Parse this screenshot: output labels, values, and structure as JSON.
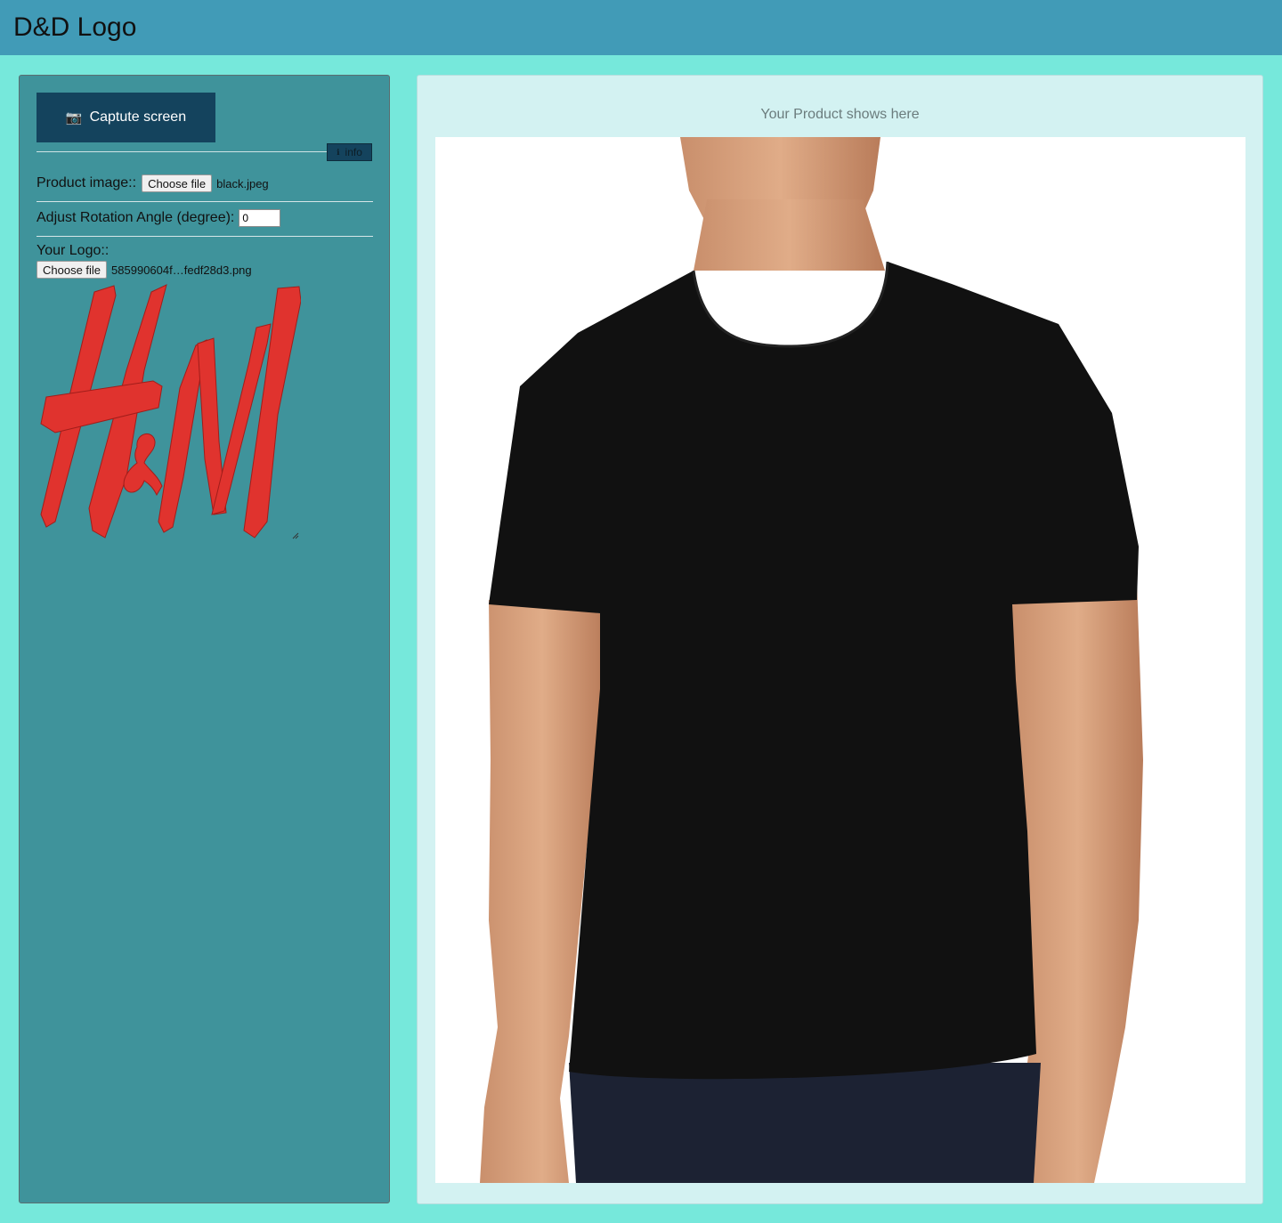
{
  "header": {
    "title": "D&D Logo"
  },
  "sidebar": {
    "capture_button": {
      "icon": "camera-icon",
      "label": "Captute screen"
    },
    "info_button": {
      "icon": "info-icon",
      "label": "info"
    },
    "product_image": {
      "label": "Product image::",
      "button": "Choose file",
      "filename": "black.jpeg"
    },
    "rotation": {
      "label": "Adjust Rotation Angle (degree):",
      "value": "0"
    },
    "logo": {
      "label": "Your Logo::",
      "button": "Choose file",
      "filename": "585990604f…fedf28d3.png",
      "image_text": "H&M",
      "color": "#e0332e"
    }
  },
  "main": {
    "placeholder": "Your Product shows here",
    "product_description": "black crew-neck t-shirt on model",
    "shirt_color": "#111111"
  },
  "colors": {
    "page_bg": "#76e8db",
    "topbar_bg": "#419bb7",
    "sidebar_bg": "#3f939b",
    "button_bg": "#14435d",
    "main_bg": "#d3f2f2"
  }
}
